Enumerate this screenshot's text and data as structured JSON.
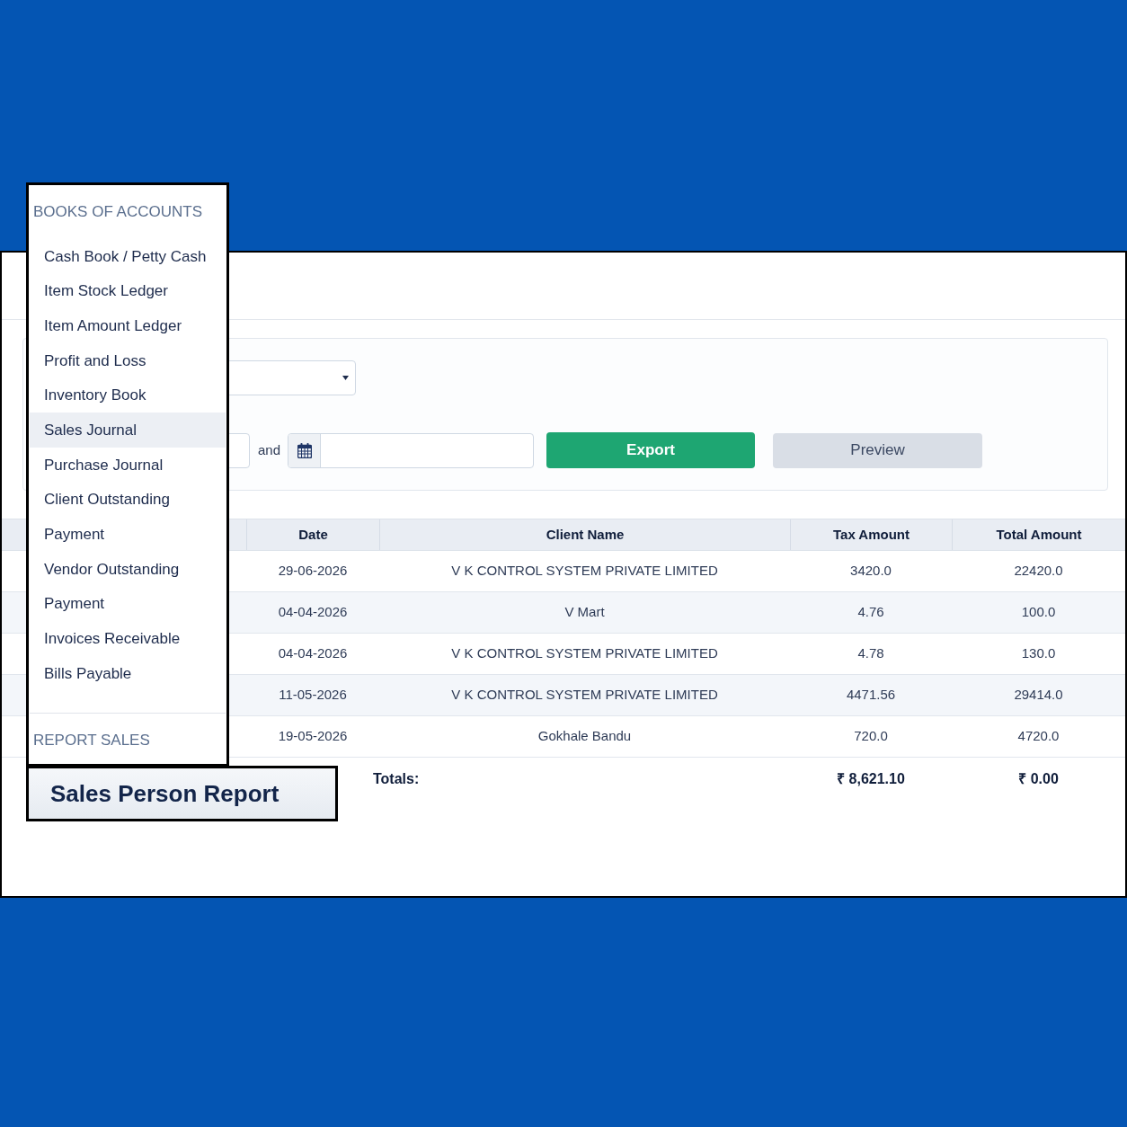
{
  "menu": {
    "heading": "BOOKS OF ACCOUNTS",
    "items": [
      {
        "label": "Cash Book / Petty Cash",
        "selected": false
      },
      {
        "label": "Item Stock Ledger",
        "selected": false
      },
      {
        "label": "Item Amount Ledger",
        "selected": false
      },
      {
        "label": "Profit and Loss",
        "selected": false
      },
      {
        "label": "Inventory Book",
        "selected": false
      },
      {
        "label": "Sales Journal",
        "selected": true
      },
      {
        "label": "Purchase Journal",
        "selected": false
      },
      {
        "label": "Client Outstanding",
        "selected": false
      },
      {
        "label": "Payment",
        "selected": false
      },
      {
        "label": "Vendor Outstanding",
        "selected": false
      },
      {
        "label": "Payment",
        "selected": false
      },
      {
        "label": "Invoices Receivable",
        "selected": false
      },
      {
        "label": "Bills Payable",
        "selected": false
      }
    ],
    "footer_heading": "REPORT SALES"
  },
  "filters": {
    "conjunction": "and",
    "buttons": [
      {
        "label": "Export",
        "kind": "primary"
      },
      {
        "label": "Preview",
        "kind": "secondary"
      }
    ]
  },
  "table": {
    "columns": [
      "Date",
      "Client Name",
      "Tax Amount",
      "Total Amount"
    ],
    "rows": [
      {
        "date": "29-06-2026",
        "client": "V K CONTROL SYSTEM PRIVATE LIMITED",
        "tax": "3420.0",
        "total": "22420.0"
      },
      {
        "date": "04-04-2026",
        "client": "V Mart",
        "tax": "4.76",
        "total": "100.0"
      },
      {
        "date": "04-04-2026",
        "client": "V K CONTROL SYSTEM PRIVATE LIMITED",
        "tax": "4.78",
        "total": "130.0"
      },
      {
        "date": "11-05-2026",
        "client": "V K CONTROL SYSTEM PRIVATE LIMITED",
        "tax": "4471.56",
        "total": "29414.0"
      },
      {
        "date": "19-05-2026",
        "client": "Gokhale Bandu",
        "tax": "720.0",
        "total": "4720.0"
      }
    ],
    "totals": {
      "label": "Totals:",
      "tax": "₹ 8,621.10",
      "total": "₹ 0.00"
    }
  },
  "callout": {
    "label": "Sales Person Report"
  }
}
